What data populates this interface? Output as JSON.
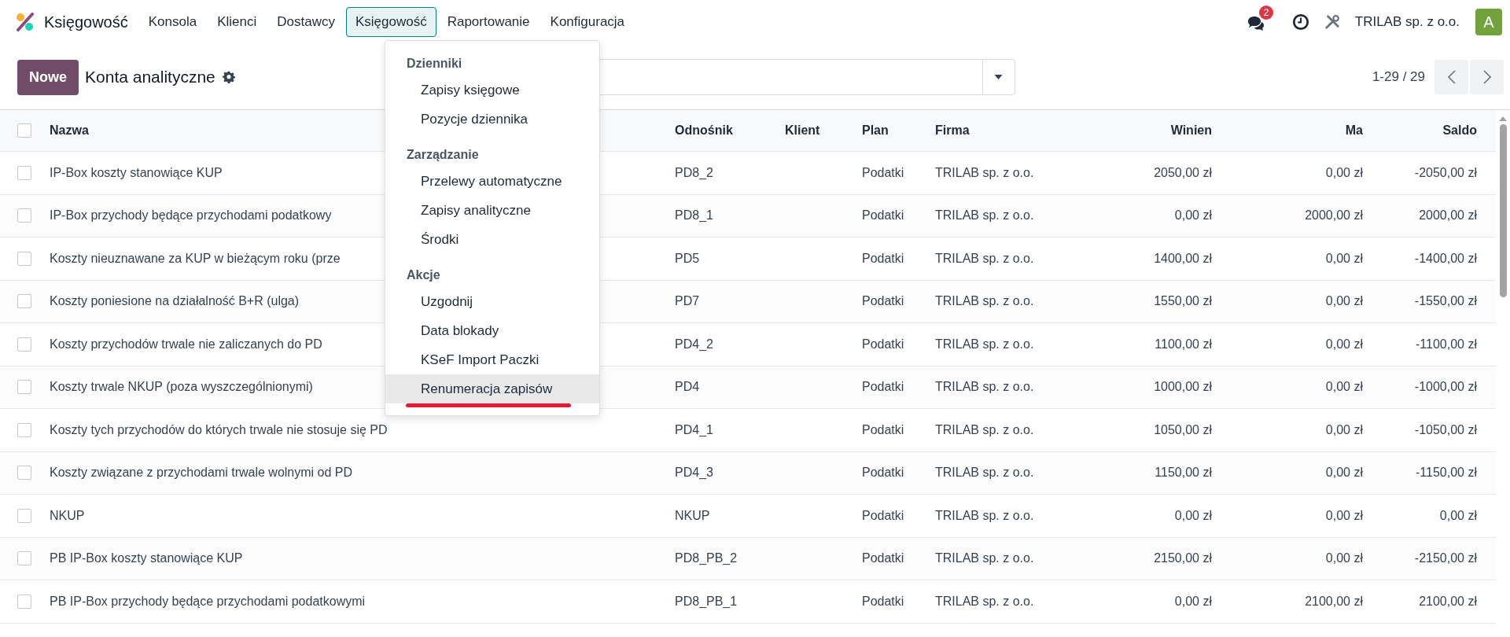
{
  "app": {
    "name": "Księgowość"
  },
  "nav": [
    {
      "label": "Konsola",
      "selected": false
    },
    {
      "label": "Klienci",
      "selected": false
    },
    {
      "label": "Dostawcy",
      "selected": false
    },
    {
      "label": "Księgowość",
      "selected": true
    },
    {
      "label": "Raportowanie",
      "selected": false
    },
    {
      "label": "Konfiguracja",
      "selected": false
    }
  ],
  "systray": {
    "messages_badge": "2",
    "company": "TRILAB sp. z o.o.",
    "avatar": "A"
  },
  "control_panel": {
    "new_button": "Nowe",
    "title": "Konta analityczne",
    "pager": "1-29 / 29"
  },
  "table": {
    "header_checked": false,
    "columns": [
      "Nazwa",
      "Odnośnik",
      "Klient",
      "Plan",
      "Firma",
      "Winien",
      "Ma",
      "Saldo"
    ],
    "rows": [
      {
        "checked": false,
        "name": "IP-Box koszty stanowiące KUP",
        "ref": "PD8_2",
        "plan": "Podatki",
        "company": "TRILAB sp. z o.o.",
        "debit": "2050,00 zł",
        "credit": "0,00 zł",
        "balance": "-2050,00 zł"
      },
      {
        "checked": false,
        "name": "IP-Box przychody będące przychodami podatkowy",
        "ref": "PD8_1",
        "plan": "Podatki",
        "company": "TRILAB sp. z o.o.",
        "debit": "0,00 zł",
        "credit": "2000,00 zł",
        "balance": "2000,00 zł"
      },
      {
        "checked": false,
        "name": "Koszty nieuznawane za KUP w bieżącym roku (prze",
        "ref": "PD5",
        "plan": "Podatki",
        "company": "TRILAB sp. z o.o.",
        "debit": "1400,00 zł",
        "credit": "0,00 zł",
        "balance": "-1400,00 zł"
      },
      {
        "checked": false,
        "name": "Koszty poniesione na działalność B+R (ulga)",
        "ref": "PD7",
        "plan": "Podatki",
        "company": "TRILAB sp. z o.o.",
        "debit": "1550,00 zł",
        "credit": "0,00 zł",
        "balance": "-1550,00 zł"
      },
      {
        "checked": false,
        "name": "Koszty przychodów trwale nie zaliczanych do PD",
        "ref": "PD4_2",
        "plan": "Podatki",
        "company": "TRILAB sp. z o.o.",
        "debit": "1100,00 zł",
        "credit": "0,00 zł",
        "balance": "-1100,00 zł"
      },
      {
        "checked": false,
        "name": "Koszty trwale NKUP (poza wyszczególnionymi)",
        "ref": "PD4",
        "plan": "Podatki",
        "company": "TRILAB sp. z o.o.",
        "debit": "1000,00 zł",
        "credit": "0,00 zł",
        "balance": "-1000,00 zł"
      },
      {
        "checked": false,
        "name": "Koszty tych przychodów do których trwale nie stosuje się PD",
        "ref": "PD4_1",
        "plan": "Podatki",
        "company": "TRILAB sp. z o.o.",
        "debit": "1050,00 zł",
        "credit": "0,00 zł",
        "balance": "-1050,00 zł"
      },
      {
        "checked": false,
        "name": "Koszty związane z przychodami trwale wolnymi od PD",
        "ref": "PD4_3",
        "plan": "Podatki",
        "company": "TRILAB sp. z o.o.",
        "debit": "1150,00 zł",
        "credit": "0,00 zł",
        "balance": "-1150,00 zł"
      },
      {
        "checked": false,
        "name": "NKUP",
        "ref": "NKUP",
        "plan": "Podatki",
        "company": "TRILAB sp. z o.o.",
        "debit": "0,00 zł",
        "credit": "0,00 zł",
        "balance": "0,00 zł"
      },
      {
        "checked": false,
        "name": "PB IP-Box koszty stanowiące KUP",
        "ref": "PD8_PB_2",
        "plan": "Podatki",
        "company": "TRILAB sp. z o.o.",
        "debit": "2150,00 zł",
        "credit": "0,00 zł",
        "balance": "-2150,00 zł"
      },
      {
        "checked": false,
        "name": "PB IP-Box przychody będące przychodami podatkowymi",
        "ref": "PD8_PB_1",
        "plan": "Podatki",
        "company": "TRILAB sp. z o.o.",
        "debit": "0,00 zł",
        "credit": "2100,00 zł",
        "balance": "2100,00 zł"
      }
    ]
  },
  "dropdown": {
    "sections": [
      {
        "title": "Dzienniki",
        "items": [
          {
            "label": "Zapisy księgowe",
            "selected": false,
            "underlined": false
          },
          {
            "label": "Pozycje dziennika",
            "selected": false,
            "underlined": false
          }
        ]
      },
      {
        "title": "Zarządzanie",
        "items": [
          {
            "label": "Przelewy automatyczne",
            "selected": false,
            "underlined": false
          },
          {
            "label": "Zapisy analityczne",
            "selected": false,
            "underlined": false
          },
          {
            "label": "Środki",
            "selected": false,
            "underlined": false
          }
        ]
      },
      {
        "title": "Akcje",
        "items": [
          {
            "label": "Uzgodnij",
            "selected": false,
            "underlined": false
          },
          {
            "label": "Data blokady",
            "selected": false,
            "underlined": false
          },
          {
            "label": "KSeF Import Paczki",
            "selected": false,
            "underlined": false
          },
          {
            "label": "Renumeracja zapisów",
            "selected": true,
            "underlined": true
          }
        ]
      }
    ]
  }
}
